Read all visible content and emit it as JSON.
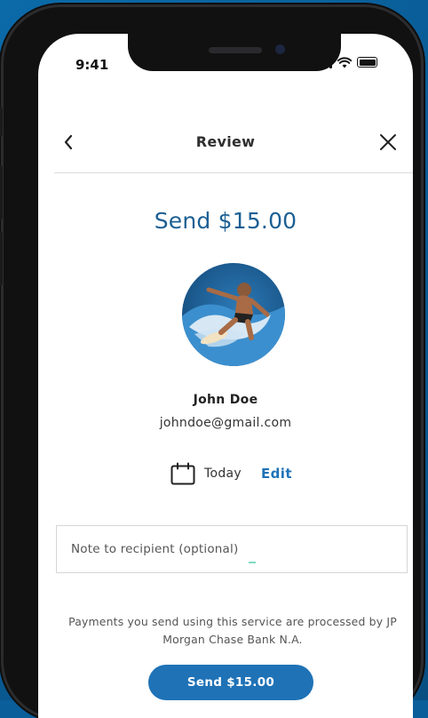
{
  "status_bar": {
    "time": "9:41"
  },
  "header": {
    "title": "Review"
  },
  "payment": {
    "amount_title": "Send $15.00",
    "recipient_name": "John Doe",
    "recipient_email": "johndoe@gmail.com",
    "date_label": "Today",
    "edit_label": "Edit"
  },
  "note": {
    "placeholder": "Note to recipient (optional)",
    "value": ""
  },
  "disclaimer": "Payments you send using this service are processed by JP Morgan Chase Bank N.A.",
  "send_button": {
    "label": "Send $15.00"
  },
  "colors": {
    "brand_blue": "#1f72b6",
    "title_blue": "#1c5f93",
    "background": "#0a5e9a"
  }
}
